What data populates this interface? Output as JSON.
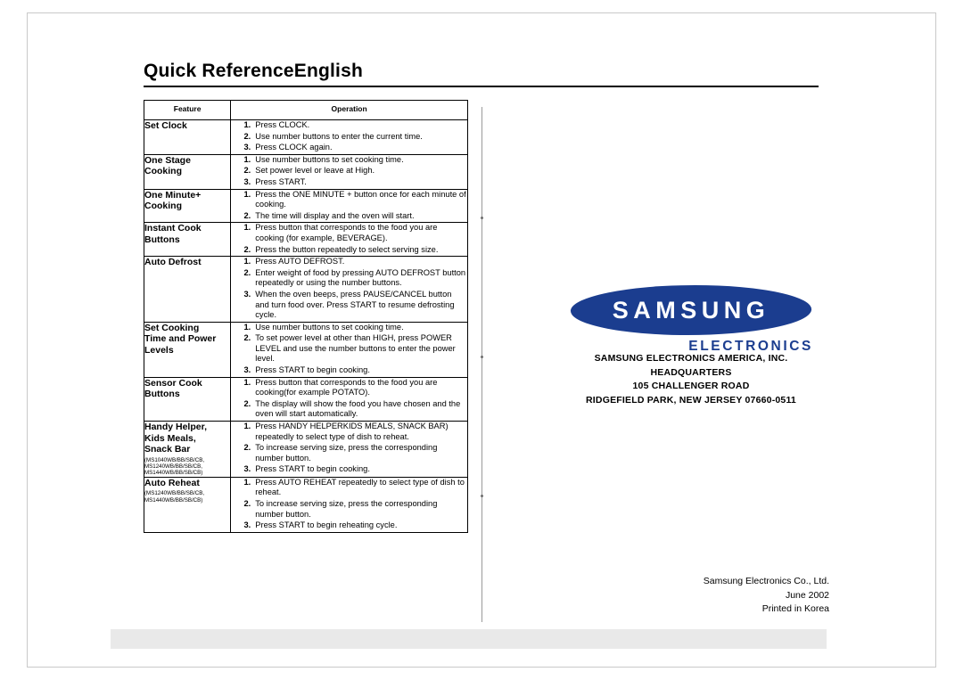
{
  "document": {
    "title": "Quick ReferenceEnglish"
  },
  "table": {
    "headers": {
      "feature": "Feature",
      "operation": "Operation"
    },
    "rows": [
      {
        "feature": "Set Clock",
        "models": "",
        "steps": [
          "Press CLOCK.",
          "Use number buttons to enter the current time.",
          "Press CLOCK again."
        ]
      },
      {
        "feature": "One Stage\nCooking",
        "models": "",
        "steps": [
          "Use number buttons to set cooking time.",
          "Set power level or leave at High.",
          "Press START."
        ]
      },
      {
        "feature": "One Minute+\nCooking",
        "models": "",
        "steps": [
          "Press the ONE MINUTE + button once for each minute of cooking.",
          "The time will display and the oven will start."
        ]
      },
      {
        "feature": "Instant Cook\nButtons",
        "models": "",
        "steps": [
          "Press button that corresponds to the food you are cooking (for example, BEVERAGE).",
          "Press the button repeatedly to select serving size."
        ]
      },
      {
        "feature": "Auto Defrost",
        "models": "",
        "steps": [
          "Press AUTO DEFROST.",
          "Enter weight of food by pressing AUTO DEFROST button repeatedly or using the number buttons.",
          "When the oven beeps, press PAUSE/CANCEL button and turn food over. Press START to resume defrosting cycle."
        ]
      },
      {
        "feature": "Set Cooking\nTime and Power\nLevels",
        "models": "",
        "steps": [
          "Use number buttons to set cooking time.",
          "To set power level at other than HIGH, press POWER LEVEL and use the number buttons to enter the power level.",
          "Press START to begin cooking."
        ]
      },
      {
        "feature": "Sensor Cook\nButtons",
        "models": "",
        "steps": [
          "Press button that corresponds to the food you are cooking(for example POTATO).",
          "The display will show the food you have chosen and the oven will start automatically."
        ]
      },
      {
        "feature": "Handy Helper,\nKids Meals,\nSnack Bar",
        "models": "(MS1040WB/BB/SB/CB,\nMS1240WB/BB/SB/CB,\nMS1440WB/BB/SB/CB)",
        "steps": [
          "Press HANDY HELPERKIDS MEALS, SNACK BAR) repeatedly to select type of dish to reheat.",
          "To increase serving size, press the corresponding number button.",
          "Press START to begin cooking."
        ]
      },
      {
        "feature": "Auto Reheat",
        "models": "(MS1240WB/BB/SB/CB,\nMS1440WB/BB/SB/CB)",
        "steps": [
          "Press AUTO REHEAT repeatedly to select type of dish to reheat.",
          "To increase serving size, press the corresponding number button.",
          "Press START to begin reheating cycle."
        ]
      }
    ]
  },
  "brand": {
    "logo_text": "SAMSUNG",
    "logo_sub": "ELECTRONICS",
    "logo_color": "#1b3d8f"
  },
  "address": {
    "line1": "SAMSUNG ELECTRONICS AMERICA, INC.",
    "line2": "HEADQUARTERS",
    "line3": "105 CHALLENGER ROAD",
    "line4": "RIDGEFIELD PARK, NEW JERSEY 07660-0511"
  },
  "colophon": {
    "line1": "Samsung Electronics Co., Ltd.",
    "line2": "June 2002",
    "line3": "Printed in Korea"
  }
}
